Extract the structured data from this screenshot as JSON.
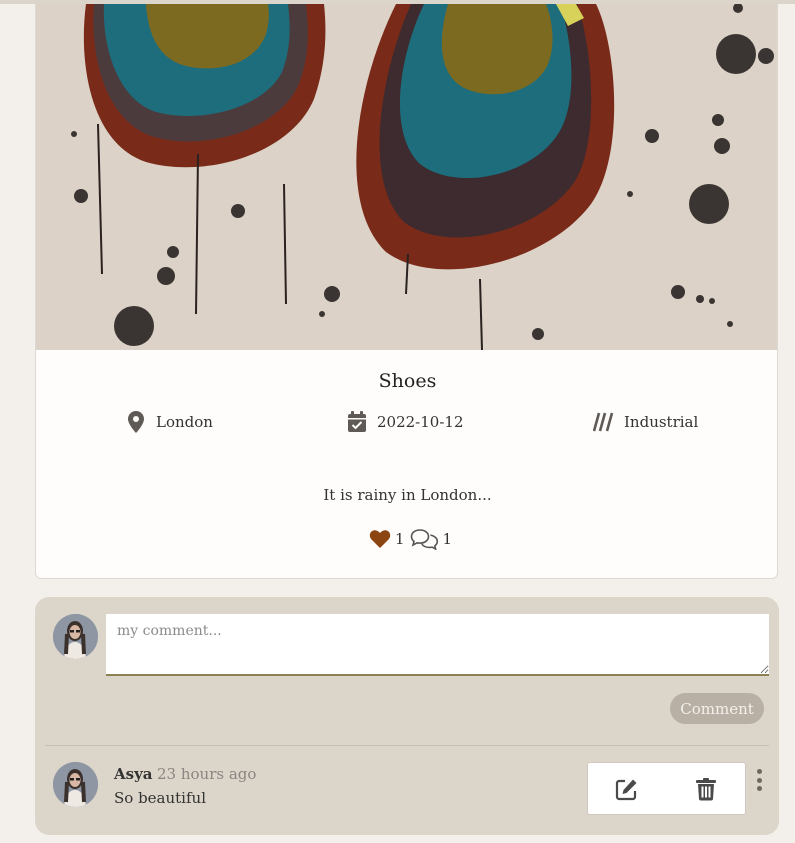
{
  "post": {
    "title": "Shoes",
    "location": "London",
    "date": "2022-10-12",
    "style": "Industrial",
    "description": "It is rainy in London...",
    "likes": "1",
    "comments_count": "1"
  },
  "comment_form": {
    "placeholder": "my comment...",
    "value": "",
    "submit_label": "Comment"
  },
  "comments": [
    {
      "author": "Asya",
      "time": "23 hours ago",
      "text": "So beautiful"
    }
  ],
  "icons": {
    "location": "map-marker-icon",
    "date": "calendar-check-icon",
    "style": "slashes-icon",
    "like": "heart-icon",
    "comment": "comments-icon",
    "edit": "edit-icon",
    "delete": "trash-icon",
    "more": "kebab-menu-icon"
  },
  "colors": {
    "accent_heart": "#8b4513",
    "comment_panel": "#dcd5ca",
    "comment_button": "#b8afa5"
  }
}
